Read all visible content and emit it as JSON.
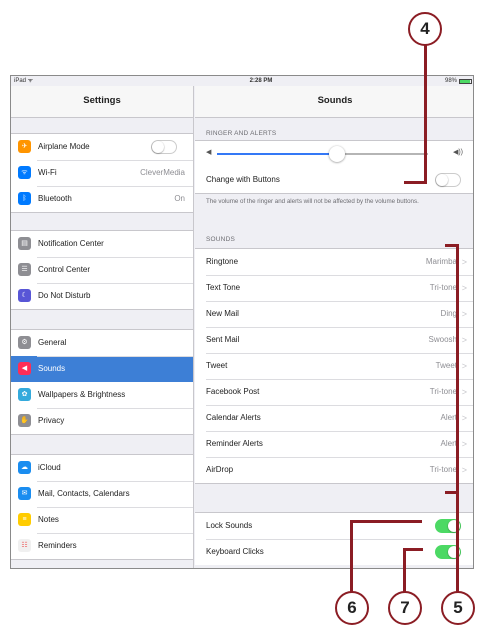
{
  "status_bar": {
    "left": "iPad ᯤ",
    "time": "2:28 PM",
    "battery": "98%"
  },
  "left": {
    "title": "Settings",
    "groups": [
      [
        {
          "icon": "airplane-icon",
          "label": "Airplane Mode",
          "toggle": "off",
          "color": "#ff9500"
        },
        {
          "icon": "wifi-icon",
          "label": "Wi-Fi",
          "value": "CleverMedia",
          "color": "#007aff"
        },
        {
          "icon": "bluetooth-icon",
          "label": "Bluetooth",
          "value": "On",
          "color": "#007aff"
        }
      ],
      [
        {
          "icon": "notification-center-icon",
          "label": "Notification Center",
          "color": "#8e8e93"
        },
        {
          "icon": "control-center-icon",
          "label": "Control Center",
          "color": "#8e8e93"
        },
        {
          "icon": "moon-icon",
          "label": "Do Not Disturb",
          "color": "#5856d6"
        }
      ],
      [
        {
          "icon": "gear-icon",
          "label": "General",
          "color": "#8e8e93"
        },
        {
          "icon": "speaker-icon",
          "label": "Sounds",
          "color": "#ff2d55",
          "selected": true
        },
        {
          "icon": "wallpaper-icon",
          "label": "Wallpapers & Brightness",
          "color": "#34aadc"
        },
        {
          "icon": "hand-icon",
          "label": "Privacy",
          "color": "#8e8e93"
        }
      ],
      [
        {
          "icon": "cloud-icon",
          "label": "iCloud",
          "color": "#1a8df0"
        },
        {
          "icon": "mail-icon",
          "label": "Mail, Contacts, Calendars",
          "color": "#1a8df0"
        },
        {
          "icon": "notes-icon",
          "label": "Notes",
          "color": "#ffcc00"
        },
        {
          "icon": "reminders-icon",
          "label": "Reminders",
          "color": "#f0f0f0"
        }
      ]
    ]
  },
  "right": {
    "title": "Sounds",
    "ringer_header": "RINGER AND ALERTS",
    "volume_level": 0.55,
    "change_with_buttons": {
      "label": "Change with Buttons",
      "toggle": "off"
    },
    "footnote": "The volume of the ringer and alerts will not be affected by the volume buttons.",
    "sounds_header": "SOUNDS",
    "sounds": [
      {
        "label": "Ringtone",
        "value": "Marimba"
      },
      {
        "label": "Text Tone",
        "value": "Tri-tone"
      },
      {
        "label": "New Mail",
        "value": "Ding"
      },
      {
        "label": "Sent Mail",
        "value": "Swoosh"
      },
      {
        "label": "Tweet",
        "value": "Tweet"
      },
      {
        "label": "Facebook Post",
        "value": "Tri-tone"
      },
      {
        "label": "Calendar Alerts",
        "value": "Alert"
      },
      {
        "label": "Reminder Alerts",
        "value": "Alert"
      },
      {
        "label": "AirDrop",
        "value": "Tri-tone"
      }
    ],
    "toggles": [
      {
        "label": "Lock Sounds",
        "toggle": "on"
      },
      {
        "label": "Keyboard Clicks",
        "toggle": "on"
      }
    ]
  },
  "callouts": {
    "c4": "4",
    "c5": "5",
    "c6": "6",
    "c7": "7"
  },
  "colors": {
    "accent": "#3d7fd6",
    "callout": "#8b1d24",
    "switch_on": "#4cd964"
  }
}
